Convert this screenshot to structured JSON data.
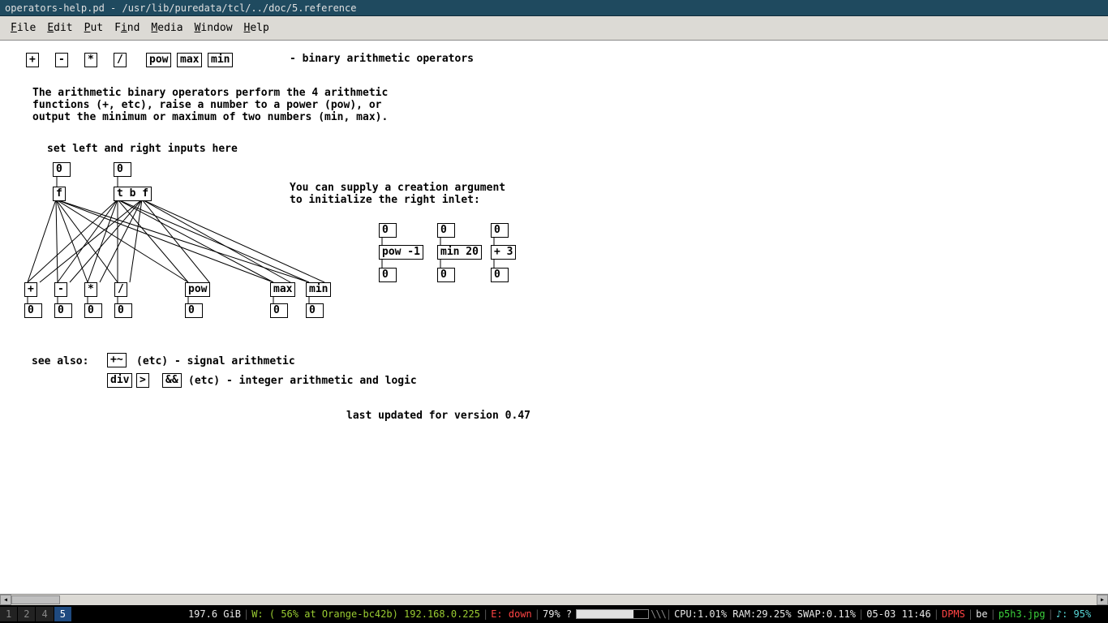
{
  "title": "operators-help.pd  - /usr/lib/puredata/tcl/../doc/5.reference",
  "menu": {
    "file": "File",
    "edit": "Edit",
    "put": "Put",
    "find": "Find",
    "media": "Media",
    "window": "Window",
    "help": "Help"
  },
  "header_ops": [
    "+",
    "-",
    "*",
    "/",
    "pow",
    "max",
    "min"
  ],
  "header_desc": "- binary arithmetic operators",
  "para": "The arithmetic binary operators perform the 4 arithmetic\nfunctions (+, etc), raise a number to a power (pow), or\noutput the minimum or maximum of two numbers (min, max).",
  "set_lr": "set left and right inputs here",
  "numL": "0",
  "numR": "0",
  "objL": "f",
  "objR": "t b f",
  "creation_txt": "You can supply a creation argument\nto initialize the right inlet:",
  "ops_row": [
    {
      "op": "+",
      "out": "0"
    },
    {
      "op": "-",
      "out": "0"
    },
    {
      "op": "*",
      "out": "0"
    },
    {
      "op": "/",
      "out": "0"
    },
    {
      "op": "pow",
      "out": "0"
    },
    {
      "op": "max",
      "out": "0"
    },
    {
      "op": "min",
      "out": "0"
    }
  ],
  "creation_examples": [
    {
      "in": "0",
      "obj": "pow -1",
      "out": "0"
    },
    {
      "in": "0",
      "obj": "min 20",
      "out": "0"
    },
    {
      "in": "0",
      "obj": "+ 3",
      "out": "0"
    }
  ],
  "see_also_label": "see also:",
  "see_also_sig": {
    "box": "+~",
    "text": "(etc) - signal arithmetic"
  },
  "see_also_int": {
    "boxes": [
      "div",
      ">",
      "&&"
    ],
    "text": "(etc) - integer arithmetic and logic"
  },
  "version": "last updated for version 0.47",
  "status": {
    "workspaces": [
      "1",
      "2",
      "4",
      "5"
    ],
    "active_ws": "5",
    "disk": "197.6 GiB",
    "wifi": "W: ( 56% at Orange-bc42b) 192.168.0.225",
    "eth": "E: down",
    "bat": "79% ?",
    "cpu": "CPU:1.01% RAM:29.25% SWAP:0.11%",
    "date": "05-03 11:46",
    "dpms": "DPMS",
    "kb": "be",
    "file": "p5h3.jpg",
    "vol": "♪: 95%"
  }
}
